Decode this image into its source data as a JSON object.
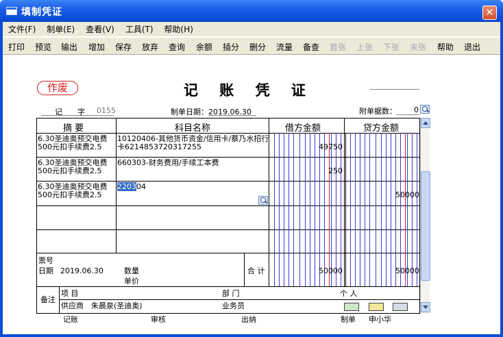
{
  "window": {
    "title": "填制凭证",
    "close_glyph": "✕"
  },
  "menu": [
    "文件(F)",
    "制单(E)",
    "查看(V)",
    "工具(T)",
    "帮助(H)"
  ],
  "toolbar": {
    "buttons": [
      {
        "label": "打印",
        "enabled": true
      },
      {
        "label": "预览",
        "enabled": true
      },
      {
        "label": "输出",
        "enabled": true
      },
      {
        "label": "增加",
        "enabled": true
      },
      {
        "label": "保存",
        "enabled": true
      },
      {
        "label": "放弃",
        "enabled": true
      },
      {
        "label": "查询",
        "enabled": true
      },
      {
        "label": "余额",
        "enabled": true
      },
      {
        "label": "插分",
        "enabled": true
      },
      {
        "label": "删分",
        "enabled": true
      },
      {
        "label": "流量",
        "enabled": true
      },
      {
        "label": "备查",
        "enabled": true
      },
      {
        "label": "首张",
        "enabled": false
      },
      {
        "label": "上张",
        "enabled": false
      },
      {
        "label": "下张",
        "enabled": false
      },
      {
        "label": "末张",
        "enabled": false
      },
      {
        "label": "帮助",
        "enabled": true
      },
      {
        "label": "退出",
        "enabled": true
      }
    ]
  },
  "voucher": {
    "stamp": "作废",
    "title": "记 账 凭 证",
    "word_label": "记",
    "zi_label": "字",
    "number": "0155",
    "date_label": "制单日期：2019.06.30",
    "attach_label": "附单据数：",
    "attach_count": "0",
    "headers": {
      "summary": "摘  要",
      "account": "科目名称",
      "debit": "借方金额",
      "credit": "贷方金额"
    },
    "rows": [
      {
        "summary": "6.30圣迪奥预交电费500元扣手续费2.5",
        "account": "10120406-其他货币资金/信用卡/蔡乃水招行卡6214853720317255",
        "debit": "49750",
        "credit": ""
      },
      {
        "summary": "6.30圣迪奥预交电费500元扣手续费2.5",
        "account": "660303-财务费用/手续工本费",
        "debit": "250",
        "credit": ""
      },
      {
        "summary": "6.30圣迪奥预交电费500元扣手续费2.5",
        "account_selected": "2203",
        "account_rest": "04",
        "debit": "",
        "credit": "50000"
      }
    ],
    "footer": {
      "ticket_label": "票号",
      "date_label": "日期",
      "date_value": "2019.06.30",
      "qty_label": "数量",
      "price_label": "单价",
      "total_label": "合 计",
      "total_debit": "50000",
      "total_credit": "50000",
      "remark_label": "备注",
      "project_label": "项  目",
      "dept_label": "部  门",
      "person_label": "个  人",
      "supplier_label": "供应商",
      "supplier_value": "朱晨泉(圣迪奥)",
      "clerk_label": "业务员"
    },
    "signatures": {
      "bookkeep": "记账",
      "audit": "审核",
      "cashier": "出纳",
      "maker_label": "制单",
      "maker_name": "申小华"
    }
  }
}
